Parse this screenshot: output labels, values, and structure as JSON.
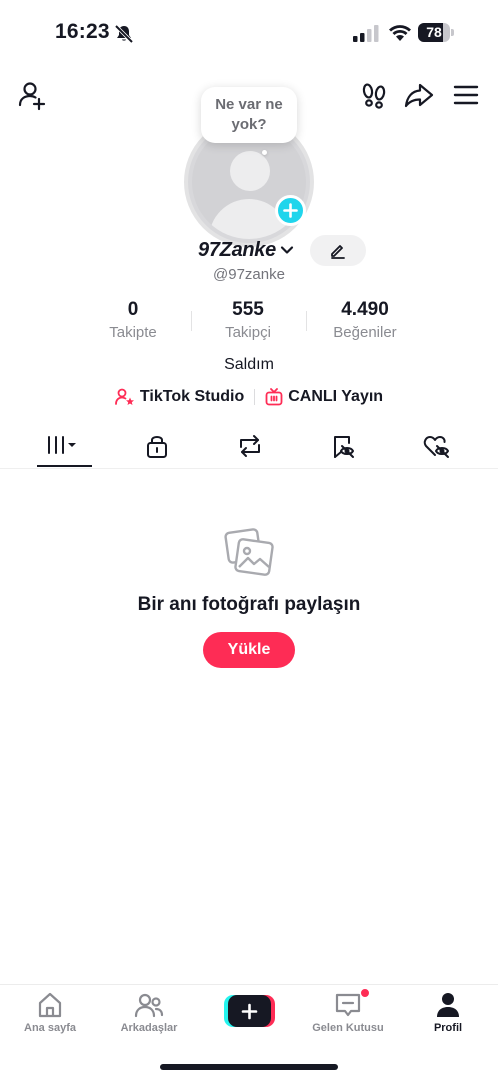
{
  "status_bar": {
    "time": "16:23",
    "battery": "78",
    "battery_level": 0.78,
    "icons": [
      "bell-muted-icon",
      "signal-icon",
      "wifi-icon",
      "battery-icon"
    ]
  },
  "top_nav": {
    "icons": [
      "add-friend-icon",
      "footprint-icon",
      "share-icon",
      "menu-icon"
    ]
  },
  "profile": {
    "note_bubble": "Ne var ne yok?",
    "username": "97Zanke",
    "handle": "@97zanke",
    "stats": [
      {
        "value": "0",
        "label": "Takipte"
      },
      {
        "value": "555",
        "label": "Takipçi"
      },
      {
        "value": "4.490",
        "label": "Beğeniler"
      }
    ],
    "bio": "Saldım",
    "links": [
      {
        "label": "TikTok Studio",
        "icon": "studio-icon"
      },
      {
        "label": "CANLI Yayın",
        "icon": "live-tv-icon"
      }
    ]
  },
  "tabs": [
    {
      "icon": "videos-grid-icon",
      "active": true
    },
    {
      "icon": "lock-icon",
      "active": false
    },
    {
      "icon": "repost-icon",
      "active": false
    },
    {
      "icon": "saved-hidden-icon",
      "active": false
    },
    {
      "icon": "liked-hidden-icon",
      "active": false
    }
  ],
  "empty_state": {
    "title": "Bir anı fotoğrafı paylaşın",
    "button": "Yükle"
  },
  "bottom_nav": [
    {
      "label": "Ana sayfa",
      "icon": "home-icon"
    },
    {
      "label": "Arkadaşlar",
      "icon": "friends-icon"
    },
    {
      "label": "",
      "icon": "create-icon"
    },
    {
      "label": "Gelen Kutusu",
      "icon": "inbox-icon"
    },
    {
      "label": "Profil",
      "icon": "profile-icon"
    }
  ],
  "colors": {
    "accent": "#fe2c55",
    "cyan": "#20d5ec",
    "text": "#161823",
    "muted": "#8a8b91"
  }
}
